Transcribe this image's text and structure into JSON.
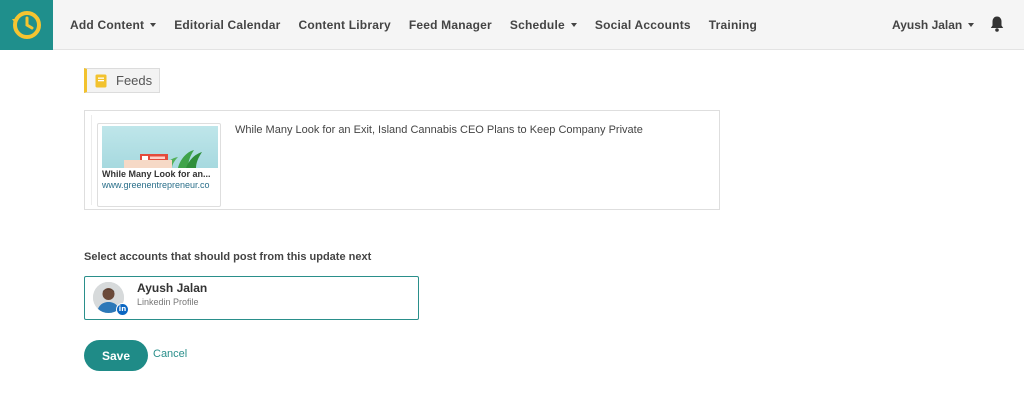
{
  "nav": {
    "items": [
      {
        "label": "Add Content",
        "dropdown": true
      },
      {
        "label": "Editorial Calendar",
        "dropdown": false
      },
      {
        "label": "Content Library",
        "dropdown": false
      },
      {
        "label": "Feed Manager",
        "dropdown": false
      },
      {
        "label": "Schedule",
        "dropdown": true
      },
      {
        "label": "Social Accounts",
        "dropdown": false
      },
      {
        "label": "Training",
        "dropdown": false
      }
    ],
    "user_name": "Ayush Jalan",
    "icons": {
      "logo": "clock-logo-icon",
      "notifications": "bell-icon"
    }
  },
  "feeds_tag": {
    "label": "Feeds",
    "icon": "book-icon"
  },
  "feed_item": {
    "preview_title": "While Many Look for an...",
    "preview_url": "www.greenentrepreneur.co",
    "headline": "While Many Look for an Exit, Island Cannabis CEO Plans to Keep Company Private"
  },
  "accounts": {
    "label": "Select accounts that should post from this update next",
    "items": [
      {
        "name": "Ayush Jalan",
        "type": "Linkedin Profile",
        "network_icon": "linkedin-icon",
        "badge_text": "in"
      }
    ]
  },
  "actions": {
    "save_label": "Save",
    "cancel_label": "Cancel"
  },
  "colors": {
    "brand": "#1f8f8c",
    "accent_yellow": "#f2c22e",
    "button": "#1f8b87",
    "linkedin": "#0a66c2"
  }
}
